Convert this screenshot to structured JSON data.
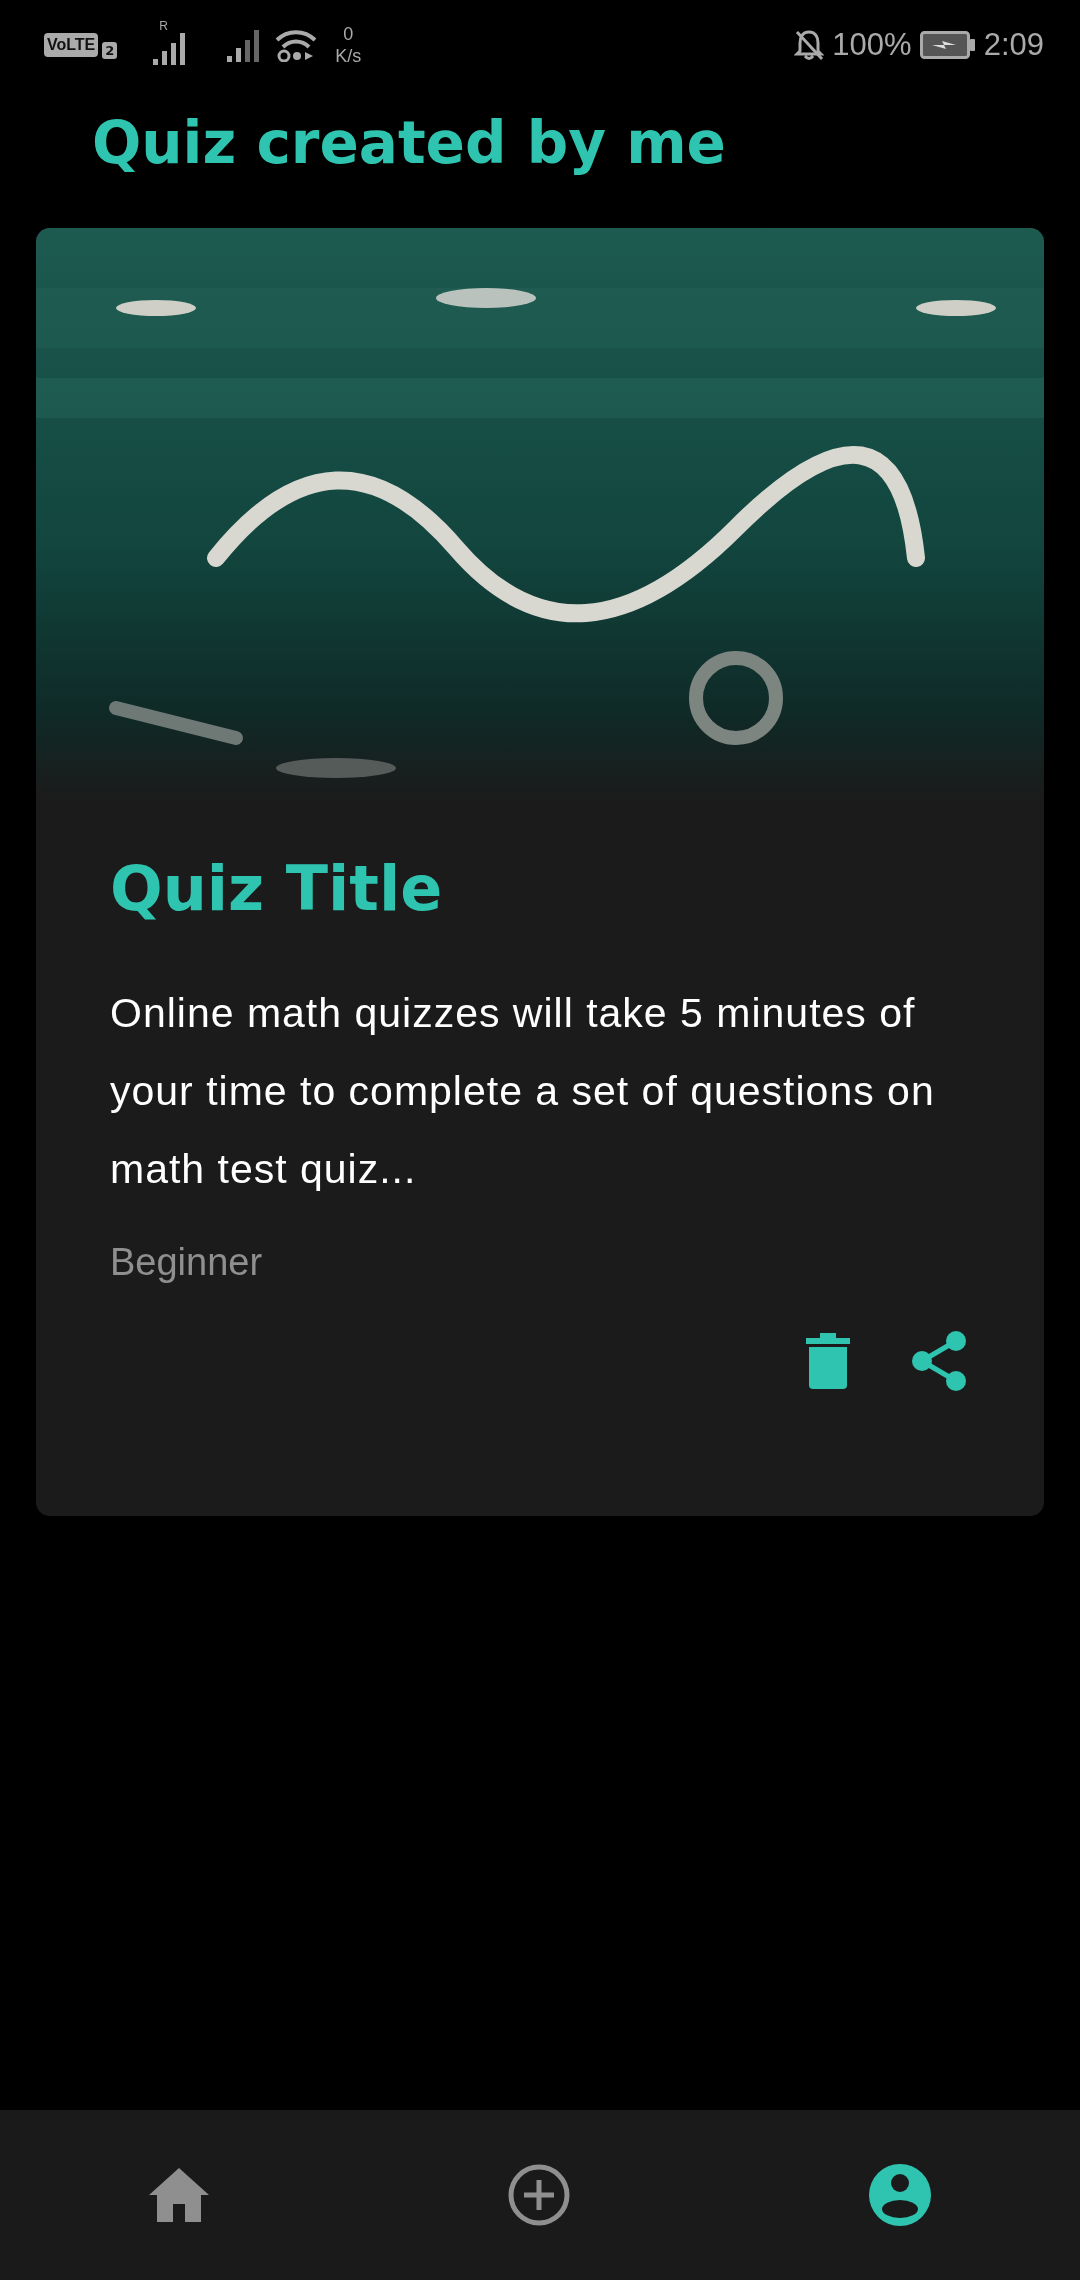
{
  "status_bar": {
    "volte": "VoLTE",
    "sim": "2",
    "roaming": "R",
    "speed_value": "0",
    "speed_unit": "K/s",
    "battery": "100%",
    "time": "2:09"
  },
  "heading": "Quiz created by me",
  "quizzes": [
    {
      "title": "Quiz Title",
      "description": "Online math quizzes will take 5 minutes of your time to complete a set of questions on math test quiz...",
      "level": "Beginner"
    }
  ],
  "bottom_nav": [
    {
      "kind": "home",
      "selected": false
    },
    {
      "kind": "add",
      "selected": false
    },
    {
      "kind": "profile",
      "selected": true
    }
  ]
}
